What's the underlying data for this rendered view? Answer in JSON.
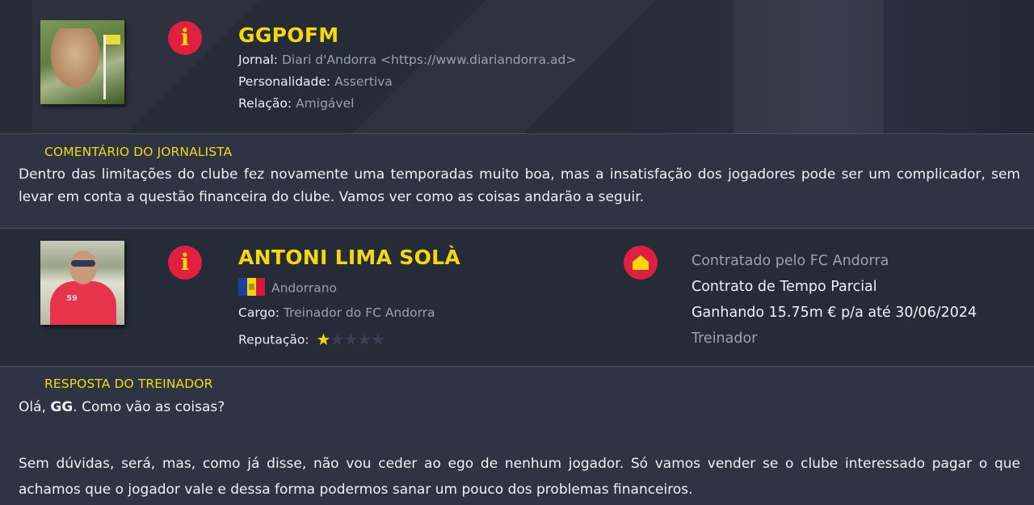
{
  "journalist": {
    "name": "GGPOFM",
    "journal_label": "Jornal:",
    "journal_value": "Diari d'Andorra <https://www.diariandorra.ad>",
    "personality_label": "Personalidade:",
    "personality_value": "Assertiva",
    "relation_label": "Relação:",
    "relation_value": "Amigável"
  },
  "comment": {
    "title": "COMENTÁRIO DO JORNALISTA",
    "text": "Dentro das limitações do clube fez novamente uma temporadas muito boa, mas a insatisfação dos jogadores pode ser um complicador, sem levar em conta a questão financeira do clube. Vamos ver como as coisas andarão a seguir."
  },
  "coach": {
    "name": "ANTONI LIMA SOLÀ",
    "nationality": "Andorrano",
    "role_label": "Cargo:",
    "role_value": "Treinador do FC Andorra",
    "reputation_label": "Reputação:",
    "reputation_stars": 1,
    "reputation_max": 5,
    "shirt_text": "59",
    "contract": {
      "line1": "Contratado pelo FC Andorra",
      "line2": "Contrato de Tempo Parcial",
      "line3": "Ganhando 15.75m € p/a até 30/06/2024",
      "line4": "Treinador"
    }
  },
  "response": {
    "title": "RESPOSTA DO TREINADOR",
    "greeting_pre": "Olá, ",
    "greeting_name": "GG",
    "greeting_post": ". Como vão as coisas?",
    "text": "Sem dúvidas, será, mas, como já disse, não vou ceder ao ego de nenhum jogador.  Só vamos vender se o clube interessado pagar o que achamos que o jogador vale e dessa forma podermos sanar um pouco dos problemas financeiros."
  },
  "icons": {
    "info": "info-icon",
    "home": "home-icon",
    "flag": "andorra-flag-icon",
    "star": "star-icon"
  },
  "colors": {
    "accent_yellow": "#f3d90b",
    "icon_red": "#e0203f",
    "background": "#262b38",
    "box_background": "#2e3444"
  }
}
